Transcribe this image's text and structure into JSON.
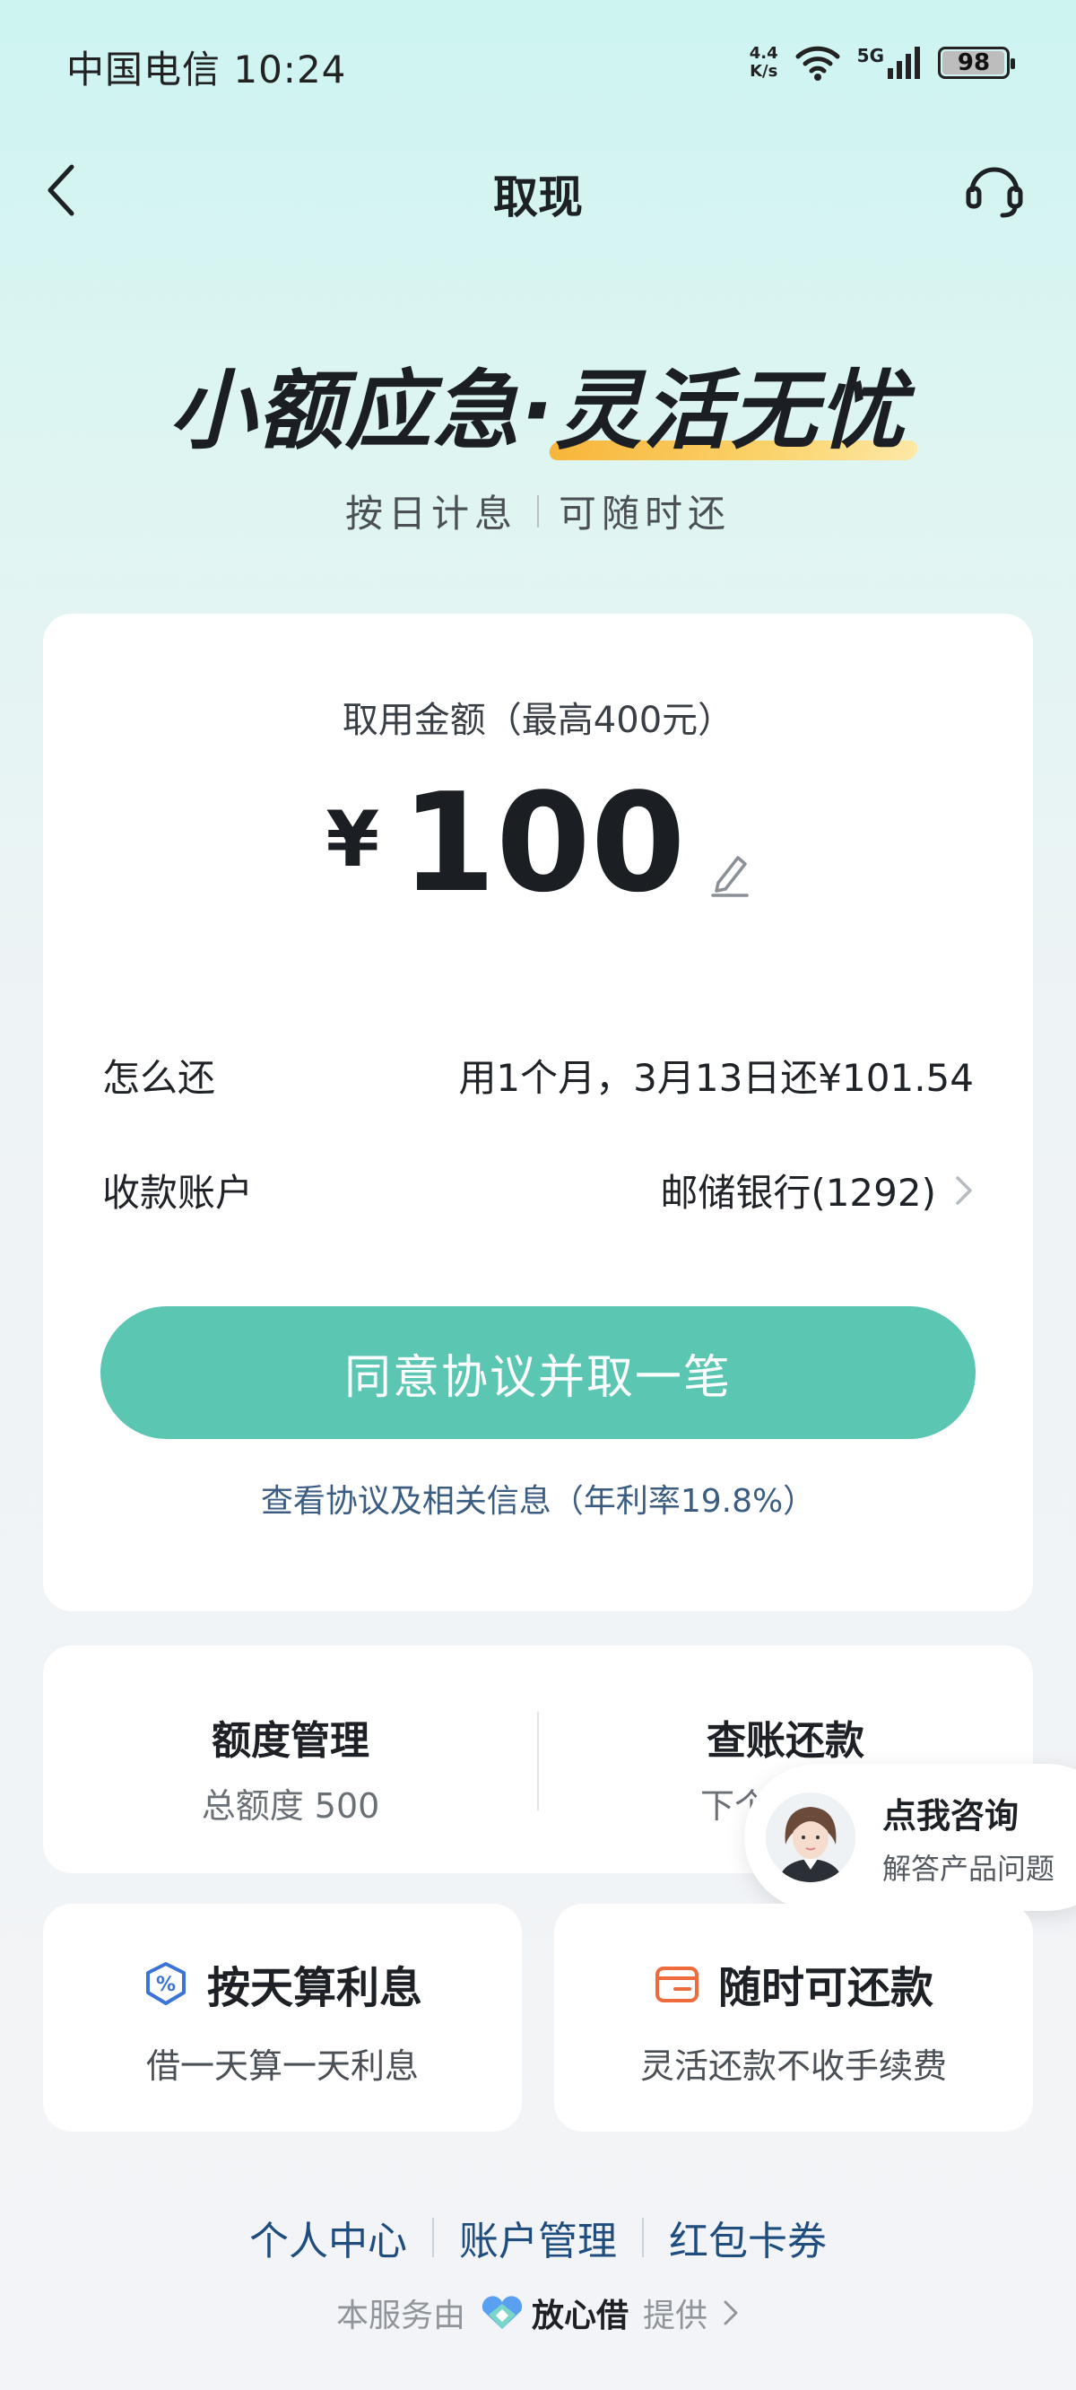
{
  "status_bar": {
    "carrier_time": "中国电信 10:24",
    "net_speed_top": "4.4",
    "net_speed_bottom": "K/s",
    "network": "5G",
    "battery": "98",
    "battery_level": 0.98
  },
  "header": {
    "title": "取现",
    "back_icon": "chevron-left-icon",
    "support_icon": "headset-icon"
  },
  "hero": {
    "title_part1": "小额应急·",
    "title_part2": "灵活无忧",
    "sub_left": "按日计息",
    "sub_right": "可随时还"
  },
  "withdraw": {
    "amount_label": "取用金额（最高400元）",
    "currency": "¥",
    "amount": "100",
    "repay_label": "怎么还",
    "repay_value": "用1个月，3月13日还¥101.54",
    "account_label": "收款账户",
    "account_value": "邮储银行(1292)",
    "cta": "同意协议并取一笔",
    "agreement": "查看协议及相关信息（年利率19.8%）",
    "accent_color": "#5bc7b2"
  },
  "quota": {
    "left_title": "额度管理",
    "left_sub": "总额度 500",
    "right_title": "查账还款",
    "right_sub": "下个还款日"
  },
  "consult": {
    "title": "点我咨询",
    "sub": "解答产品问题"
  },
  "features": [
    {
      "icon": "percent-shield-icon",
      "title": "按天算利息",
      "sub": "借一天算一天利息"
    },
    {
      "icon": "wallet-icon",
      "title": "随时可还款",
      "sub": "灵活还款不收手续费"
    }
  ],
  "footer": {
    "links": [
      "个人中心",
      "账户管理",
      "红包卡券"
    ],
    "provider_prefix": "本服务由",
    "brand": "放心借",
    "provider_suffix": "提供"
  }
}
